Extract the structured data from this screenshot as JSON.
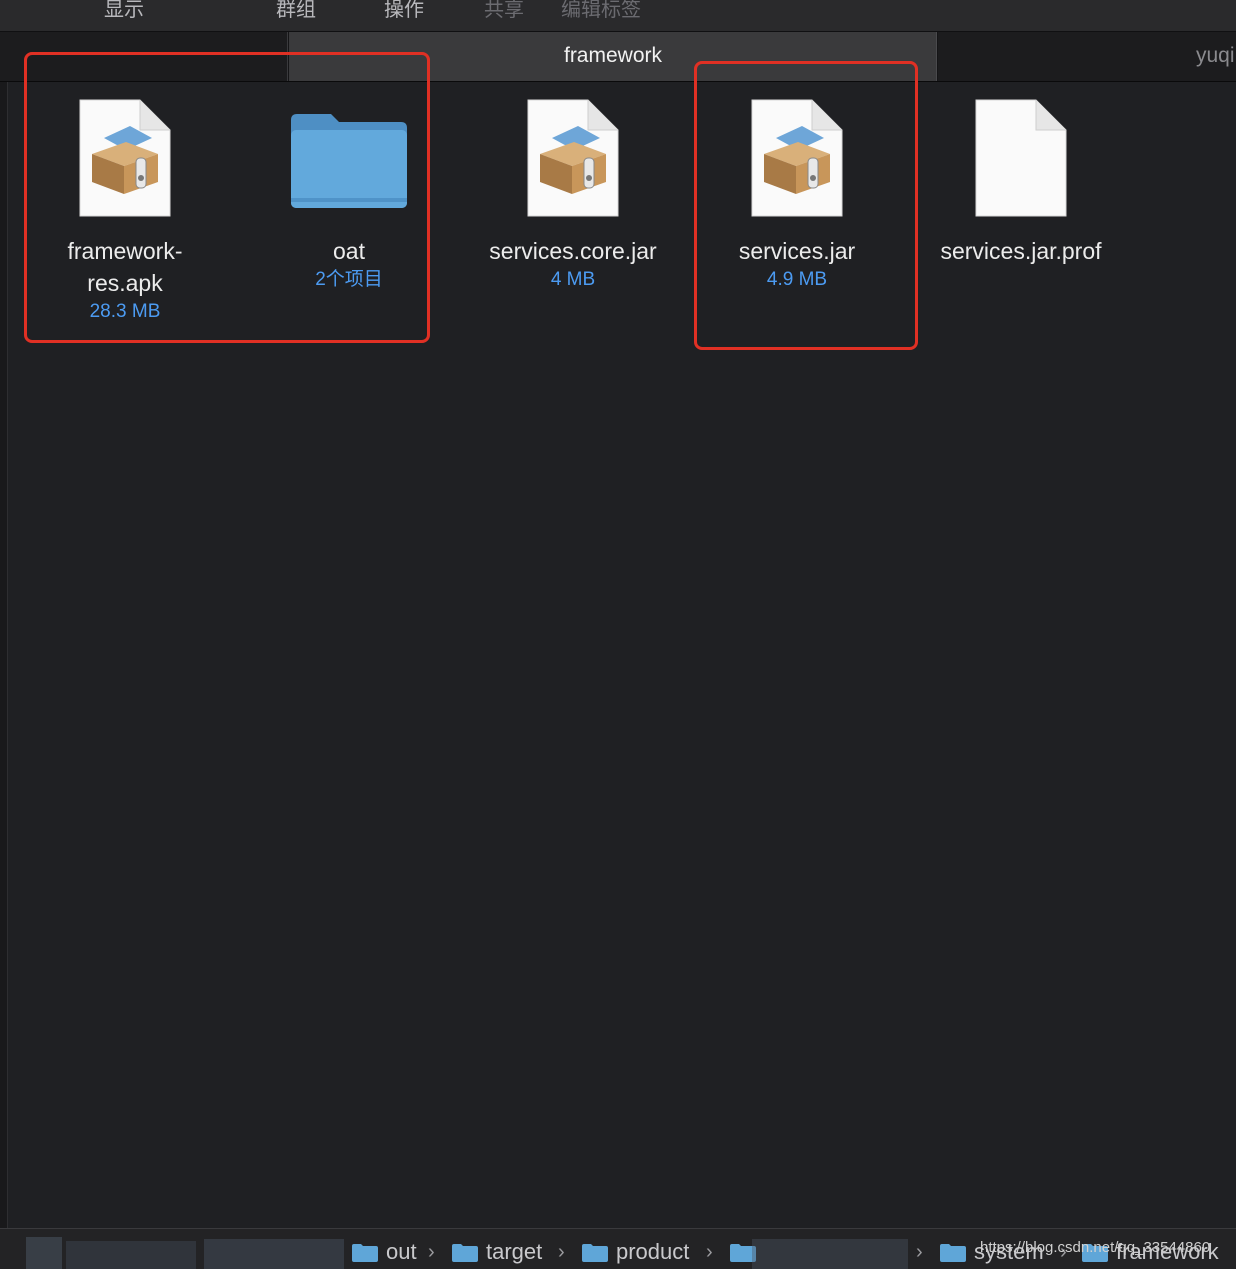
{
  "toolbar": {
    "view": "显示",
    "group": "群组",
    "action": "操作",
    "share": "共享",
    "edit_tags": "编辑标签"
  },
  "tabs": {
    "active": "framework",
    "right": "yuqi"
  },
  "files": [
    {
      "name": "framework-\nres.apk",
      "line1": "framework-",
      "line2": "res.apk",
      "meta": "28.3 MB",
      "icon": "archive-icon"
    },
    {
      "name": "oat",
      "meta": "2个项目",
      "icon": "folder-icon"
    },
    {
      "name": "services.core.jar",
      "meta": "4 MB",
      "icon": "archive-icon"
    },
    {
      "name": "services.jar",
      "meta": "4.9 MB",
      "icon": "archive-icon"
    },
    {
      "name": "services.jar.prof",
      "meta": "",
      "icon": "document-icon"
    }
  ],
  "pathbar": {
    "crumbs": [
      "out",
      "target",
      "product",
      "system",
      "framework"
    ]
  },
  "watermark": "https://blog.csdn.net/qq_33544860",
  "colors": {
    "highlight": "#e03024",
    "meta_text": "#4c9bf2",
    "folder": "#5fa6d8"
  }
}
